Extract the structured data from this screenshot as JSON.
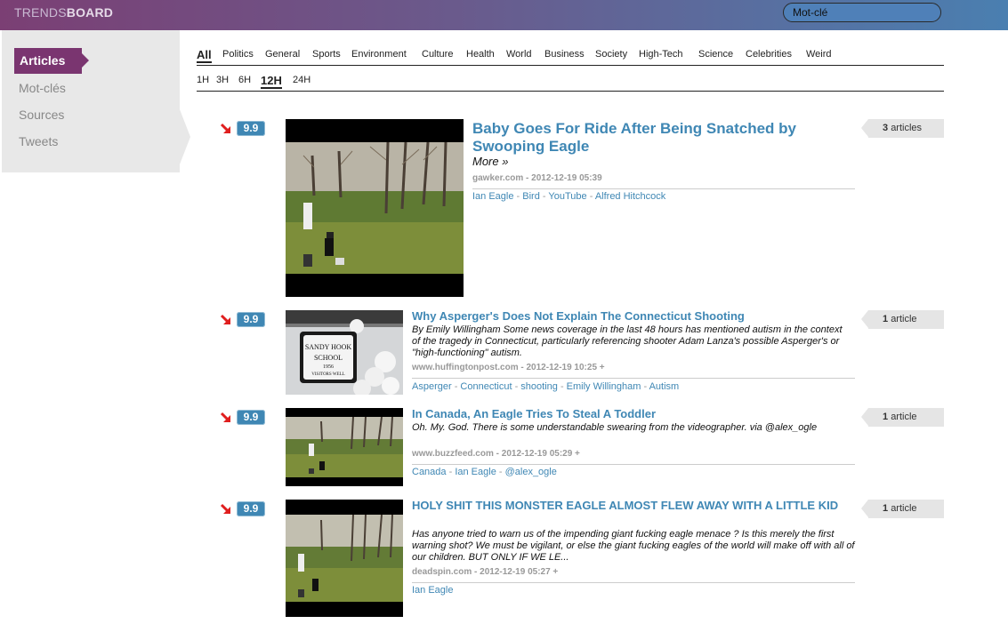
{
  "header": {
    "logo_light": "TRENDS",
    "logo_bold": "BOARD",
    "search_value": "Mot-clé"
  },
  "sidebar": {
    "items": [
      {
        "label": "Articles"
      },
      {
        "label": "Mot-clés"
      },
      {
        "label": "Sources"
      },
      {
        "label": "Tweets"
      }
    ]
  },
  "categories": [
    "All",
    "Politics",
    "General",
    "Sports",
    "Environment",
    "Culture",
    "Health",
    "World",
    "Business",
    "Society",
    "High-Tech",
    "Science",
    "Celebrities",
    "Weird"
  ],
  "time_filters": [
    "1H",
    "3H",
    "6H",
    "12H",
    "24H"
  ],
  "articles": [
    {
      "score": "9.9",
      "title": "Baby Goes For Ride After Being Snatched by Swooping Eagle",
      "more": "More »",
      "source": "gawker.com",
      "date": "- 2012-12-19 05:39",
      "tags": [
        "Ian Eagle",
        "Bird",
        "YouTube",
        "Alfred Hitchcock"
      ],
      "count_num": "3",
      "count_label": "articles"
    },
    {
      "score": "9.9",
      "title": "Why Asperger's Does Not Explain The Connecticut Shooting",
      "summary": "By Emily Willingham Some news coverage in the last 48 hours has mentioned autism in the context of the tragedy in Connecticut, particularly referencing shooter Adam Lanza's possible Asperger's or \"high-functioning\" autism.",
      "source": "www.huffingtonpost.com",
      "date": "- 2012-12-19 10:25 +",
      "tags": [
        "Asperger",
        "Connecticut",
        "shooting",
        "Emily Willingham",
        "Autism"
      ],
      "count_num": "1",
      "count_label": "article",
      "sign_lines": [
        "SANDY HOOK",
        "SCHOOL",
        "1956",
        "VISITORS WELL"
      ]
    },
    {
      "score": "9.9",
      "title": "In Canada, An Eagle Tries To Steal A Toddler",
      "summary": "Oh. My. God. There is some understandable swearing from the videographer. via @alex_ogle",
      "source": "www.buzzfeed.com",
      "date": "- 2012-12-19 05:29 +",
      "tags": [
        "Canada",
        "Ian Eagle",
        "@alex_ogle"
      ],
      "count_num": "1",
      "count_label": "article"
    },
    {
      "score": "9.9",
      "title": "HOLY SHIT THIS MONSTER EAGLE ALMOST FLEW AWAY WITH A LITTLE KID",
      "summary": "Has anyone tried to warn us of the impending giant fucking eagle menace ? Is this merely the first warning shot? We must be vigilant, or else the giant fucking eagles of the world will make off with all of our children. BUT ONLY IF WE LE...",
      "source": "deadspin.com",
      "date": "- 2012-12-19 05:27 +",
      "tags": [
        "Ian Eagle"
      ],
      "count_num": "1",
      "count_label": "article"
    }
  ],
  "colors": {
    "accent": "#3f87b4",
    "sidebar_active": "#7a3570",
    "trend_arrow": "#e01e1e"
  }
}
